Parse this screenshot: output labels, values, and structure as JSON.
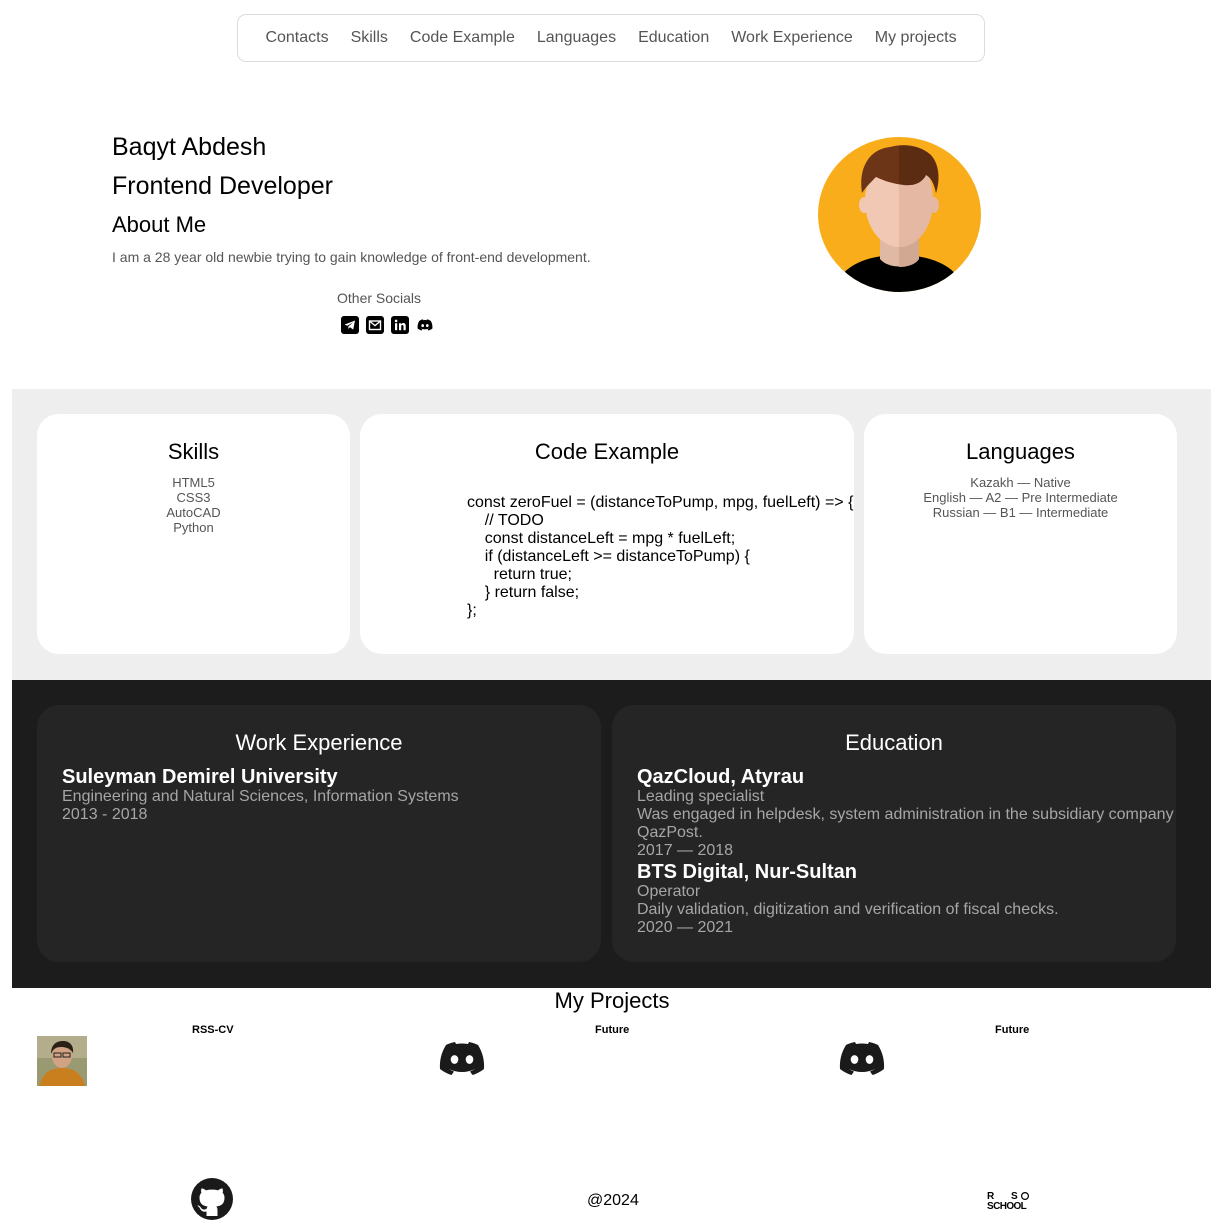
{
  "nav": {
    "items": [
      {
        "label": "Contacts"
      },
      {
        "label": "Skills"
      },
      {
        "label": "Code Example"
      },
      {
        "label": "Languages"
      },
      {
        "label": "Education"
      },
      {
        "label": "Work Experience"
      },
      {
        "label": "My projects"
      }
    ]
  },
  "hero": {
    "name": "Baqyt Abdesh",
    "role": "Frontend Developer",
    "about_title": "About Me",
    "about_text": "I am a 28 year old newbie trying to gain knowledge of front-end development.",
    "socials_title": "Other Socials",
    "socials": [
      "telegram-icon",
      "gmail-icon",
      "linkedin-icon",
      "discord-icon"
    ]
  },
  "skills": {
    "title": "Skills",
    "items": [
      "HTML5",
      "CSS3",
      "AutoCAD",
      "Python"
    ]
  },
  "code": {
    "title": "Code Example",
    "lines": [
      "const zeroFuel = (distanceToPump, mpg, fuelLeft) => {",
      "    // TODO",
      "    const distanceLeft = mpg * fuelLeft;",
      "    if (distanceLeft >= distanceToPump) {",
      "      return true;",
      "    } return false;",
      "};"
    ]
  },
  "languages": {
    "title": "Languages",
    "items": [
      "Kazakh — Native",
      "English — A2 — Pre Intermediate",
      "Russian — B1 — Intermediate"
    ]
  },
  "work": {
    "title": "Work Experience",
    "entries": [
      {
        "name": "Suleyman Demirel University",
        "line1": "Engineering and Natural Sciences, Information Systems",
        "line2": "2013 - 2018"
      }
    ]
  },
  "education": {
    "title": "Education",
    "entries": [
      {
        "name": "QazCloud, Atyrau",
        "role": "Leading specialist",
        "desc1": "Was engaged in helpdesk, system administration in the subsidiary company",
        "desc2": "QazPost.",
        "dates": "2017 — 2018"
      },
      {
        "name": "BTS Digital, Nur-Sultan",
        "role": "Operator",
        "desc1": "Daily validation, digitization and verification of fiscal checks.",
        "dates": "2020 — 2021"
      }
    ]
  },
  "projects": {
    "title": "My Projects",
    "items": [
      {
        "label": "RSS-CV",
        "icon": "project-photo"
      },
      {
        "label": "Future",
        "icon": "discord-icon"
      },
      {
        "label": "Future",
        "icon": "discord-icon"
      }
    ]
  },
  "footer": {
    "copyright": "@2024",
    "github_icon": "github-icon",
    "rss_logo": "RS SCHOOL"
  },
  "colors": {
    "accent_avatar": "#f9ad1b",
    "dark_band": "#1c1c1c",
    "dark_card": "#252525",
    "grey_band": "#eeeeee"
  }
}
